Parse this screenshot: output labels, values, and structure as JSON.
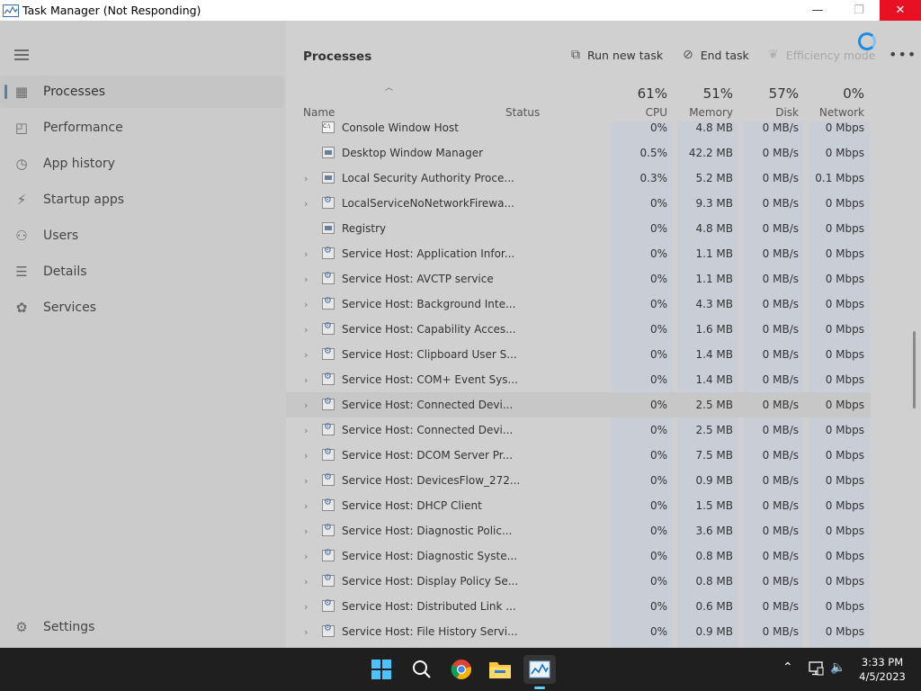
{
  "window": {
    "title": "Task Manager (Not Responding)",
    "minimize_glyph": "—",
    "maximize_glyph": "❐",
    "close_glyph": "✕"
  },
  "sidebar": {
    "items": [
      {
        "label": "Processes",
        "icon": "processes-icon",
        "glyph": "▦",
        "active": true
      },
      {
        "label": "Performance",
        "icon": "performance-icon",
        "glyph": "◰"
      },
      {
        "label": "App history",
        "icon": "app-history-icon",
        "glyph": "◷"
      },
      {
        "label": "Startup apps",
        "icon": "startup-apps-icon",
        "glyph": "⚡"
      },
      {
        "label": "Users",
        "icon": "users-icon",
        "glyph": "⚇"
      },
      {
        "label": "Details",
        "icon": "details-icon",
        "glyph": "☰"
      },
      {
        "label": "Services",
        "icon": "services-icon",
        "glyph": "✿"
      }
    ],
    "settings": {
      "label": "Settings",
      "icon": "settings-icon",
      "glyph": "⚙"
    }
  },
  "toolbar": {
    "page_title": "Processes",
    "run_new_task": "Run new task",
    "end_task": "End task",
    "efficiency_mode": "Efficiency mode",
    "more": "•••"
  },
  "columns": {
    "name": "Name",
    "status": "Status",
    "cpu": {
      "pct": "61%",
      "label": "CPU"
    },
    "memory": {
      "pct": "51%",
      "label": "Memory"
    },
    "disk": {
      "pct": "57%",
      "label": "Disk"
    },
    "network": {
      "pct": "0%",
      "label": "Network"
    }
  },
  "processes": [
    {
      "name": "Console Window Host",
      "icon": "console",
      "expandable": false,
      "cpu": "0%",
      "mem": "4.8 MB",
      "disk": "0 MB/s",
      "net": "0 Mbps"
    },
    {
      "name": "Desktop Window Manager",
      "icon": "window",
      "expandable": false,
      "cpu": "0.5%",
      "mem": "42.2 MB",
      "disk": "0 MB/s",
      "net": "0 Mbps"
    },
    {
      "name": "Local Security Authority Proce...",
      "icon": "window",
      "expandable": true,
      "cpu": "0.3%",
      "mem": "5.2 MB",
      "disk": "0 MB/s",
      "net": "0.1 Mbps"
    },
    {
      "name": "LocalServiceNoNetworkFirewa...",
      "icon": "gear",
      "expandable": true,
      "cpu": "0%",
      "mem": "9.3 MB",
      "disk": "0 MB/s",
      "net": "0 Mbps"
    },
    {
      "name": "Registry",
      "icon": "window",
      "expandable": false,
      "cpu": "0%",
      "mem": "4.8 MB",
      "disk": "0 MB/s",
      "net": "0 Mbps"
    },
    {
      "name": "Service Host: Application Infor...",
      "icon": "gear",
      "expandable": true,
      "cpu": "0%",
      "mem": "1.1 MB",
      "disk": "0 MB/s",
      "net": "0 Mbps"
    },
    {
      "name": "Service Host: AVCTP service",
      "icon": "gear",
      "expandable": true,
      "cpu": "0%",
      "mem": "1.1 MB",
      "disk": "0 MB/s",
      "net": "0 Mbps"
    },
    {
      "name": "Service Host: Background Inte...",
      "icon": "gear",
      "expandable": true,
      "cpu": "0%",
      "mem": "4.3 MB",
      "disk": "0 MB/s",
      "net": "0 Mbps"
    },
    {
      "name": "Service Host: Capability Acces...",
      "icon": "gear",
      "expandable": true,
      "cpu": "0%",
      "mem": "1.6 MB",
      "disk": "0 MB/s",
      "net": "0 Mbps"
    },
    {
      "name": "Service Host: Clipboard User S...",
      "icon": "gear",
      "expandable": true,
      "cpu": "0%",
      "mem": "1.4 MB",
      "disk": "0 MB/s",
      "net": "0 Mbps"
    },
    {
      "name": "Service Host: COM+ Event Sys...",
      "icon": "gear",
      "expandable": true,
      "cpu": "0%",
      "mem": "1.4 MB",
      "disk": "0 MB/s",
      "net": "0 Mbps"
    },
    {
      "name": "Service Host: Connected Devi...",
      "icon": "gear",
      "expandable": true,
      "cpu": "0%",
      "mem": "2.5 MB",
      "disk": "0 MB/s",
      "net": "0 Mbps",
      "highlight": true
    },
    {
      "name": "Service Host: Connected Devi...",
      "icon": "gear",
      "expandable": true,
      "cpu": "0%",
      "mem": "2.5 MB",
      "disk": "0 MB/s",
      "net": "0 Mbps"
    },
    {
      "name": "Service Host: DCOM Server Pr...",
      "icon": "gear",
      "expandable": true,
      "cpu": "0%",
      "mem": "7.5 MB",
      "disk": "0 MB/s",
      "net": "0 Mbps"
    },
    {
      "name": "Service Host: DevicesFlow_272...",
      "icon": "gear",
      "expandable": true,
      "cpu": "0%",
      "mem": "0.9 MB",
      "disk": "0 MB/s",
      "net": "0 Mbps"
    },
    {
      "name": "Service Host: DHCP Client",
      "icon": "gear",
      "expandable": true,
      "cpu": "0%",
      "mem": "1.5 MB",
      "disk": "0 MB/s",
      "net": "0 Mbps"
    },
    {
      "name": "Service Host: Diagnostic Polic...",
      "icon": "gear",
      "expandable": true,
      "cpu": "0%",
      "mem": "3.6 MB",
      "disk": "0 MB/s",
      "net": "0 Mbps"
    },
    {
      "name": "Service Host: Diagnostic Syste...",
      "icon": "gear",
      "expandable": true,
      "cpu": "0%",
      "mem": "0.8 MB",
      "disk": "0 MB/s",
      "net": "0 Mbps"
    },
    {
      "name": "Service Host: Display Policy Se...",
      "icon": "gear",
      "expandable": true,
      "cpu": "0%",
      "mem": "0.8 MB",
      "disk": "0 MB/s",
      "net": "0 Mbps"
    },
    {
      "name": "Service Host: Distributed Link ...",
      "icon": "gear",
      "expandable": true,
      "cpu": "0%",
      "mem": "0.6 MB",
      "disk": "0 MB/s",
      "net": "0 Mbps"
    },
    {
      "name": "Service Host: File History Servi...",
      "icon": "gear",
      "expandable": true,
      "cpu": "0%",
      "mem": "0.9 MB",
      "disk": "0 MB/s",
      "net": "0 Mbps"
    }
  ],
  "taskbar": {
    "apps": [
      "start-icon",
      "search-icon",
      "chrome-icon",
      "file-explorer-icon",
      "task-manager-icon"
    ],
    "time": "3:33 PM",
    "date": "4/5/2023",
    "tray_chevron": "⌃",
    "tray_volume": "🔈"
  }
}
